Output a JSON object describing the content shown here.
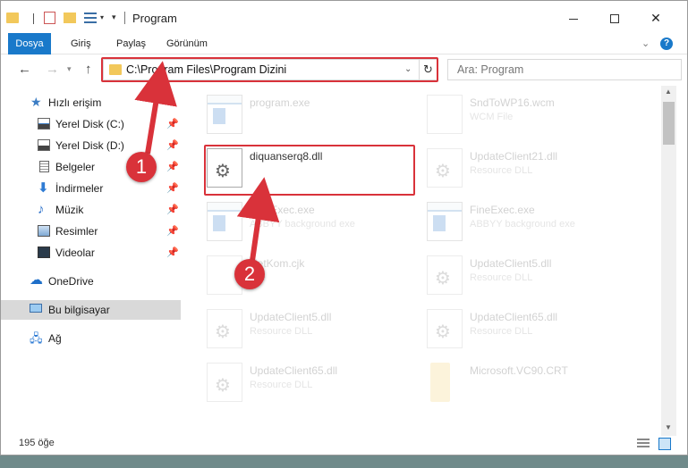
{
  "window": {
    "title": "Program",
    "quick_access_separator": "|"
  },
  "ribbon": {
    "tabs": [
      {
        "label": "Dosya"
      },
      {
        "label": "Giriş"
      },
      {
        "label": "Paylaş"
      },
      {
        "label": "Görünüm"
      }
    ]
  },
  "address": {
    "path": "C:\\Program Files\\Program Dizini"
  },
  "search": {
    "placeholder": "Ara: Program"
  },
  "nav_pane": {
    "items": [
      {
        "label": "Hızlı erişim",
        "icon": "star-icon",
        "pinned": false
      },
      {
        "label": "Yerel Disk (C:)",
        "icon": "drive-icon",
        "pinned": true
      },
      {
        "label": "Yerel Disk (D:)",
        "icon": "drive-icon",
        "pinned": true
      },
      {
        "label": "Belgeler",
        "icon": "document-icon",
        "pinned": true
      },
      {
        "label": "İndirmeler",
        "icon": "download-icon",
        "pinned": true
      },
      {
        "label": "Müzik",
        "icon": "music-icon",
        "pinned": true
      },
      {
        "label": "Resimler",
        "icon": "pictures-icon",
        "pinned": true
      },
      {
        "label": "Videolar",
        "icon": "videos-icon",
        "pinned": true
      },
      {
        "label": "OneDrive",
        "icon": "cloud-icon",
        "pinned": false
      },
      {
        "label": "Bu bilgisayar",
        "icon": "computer-icon",
        "pinned": false,
        "selected": true
      },
      {
        "label": "Ağ",
        "icon": "network-icon",
        "pinned": false
      }
    ]
  },
  "files": [
    {
      "name": "program.exe",
      "type": "",
      "icon": "exe-icon"
    },
    {
      "name": "SndToWP16.wcm",
      "type": "WCM File",
      "icon": "file-icon"
    },
    {
      "name": "diquanserq8.dll",
      "type": "",
      "icon": "dll-icon",
      "highlighted": true
    },
    {
      "name": "UpdateClient21.dll",
      "type": "Resource DLL",
      "icon": "dll-icon"
    },
    {
      "name": "FineExec.exe",
      "type": "ABBYY background exe",
      "icon": "exe-icon"
    },
    {
      "name": "FineExec.exe",
      "type": "ABBYY background exe",
      "icon": "exe-icon"
    },
    {
      "name": "NetKom.cjk",
      "type": "File",
      "icon": "file-icon"
    },
    {
      "name": "UpdateClient5.dll",
      "type": "Resource DLL",
      "icon": "dll-icon"
    },
    {
      "name": "UpdateClient5.dll",
      "type": "Resource DLL",
      "icon": "dll-icon"
    },
    {
      "name": "UpdateClient65.dll",
      "type": "Resource DLL",
      "icon": "dll-icon"
    },
    {
      "name": "UpdateClient65.dll",
      "type": "Resource DLL",
      "icon": "dll-icon"
    },
    {
      "name": "Microsoft.VC90.CRT",
      "type": "",
      "icon": "folder-icon"
    }
  ],
  "status": {
    "item_count": "195 öğe"
  },
  "callouts": [
    {
      "number": "1"
    },
    {
      "number": "2"
    }
  ],
  "colors": {
    "accent": "#1979ca",
    "highlight": "#d9323a"
  }
}
